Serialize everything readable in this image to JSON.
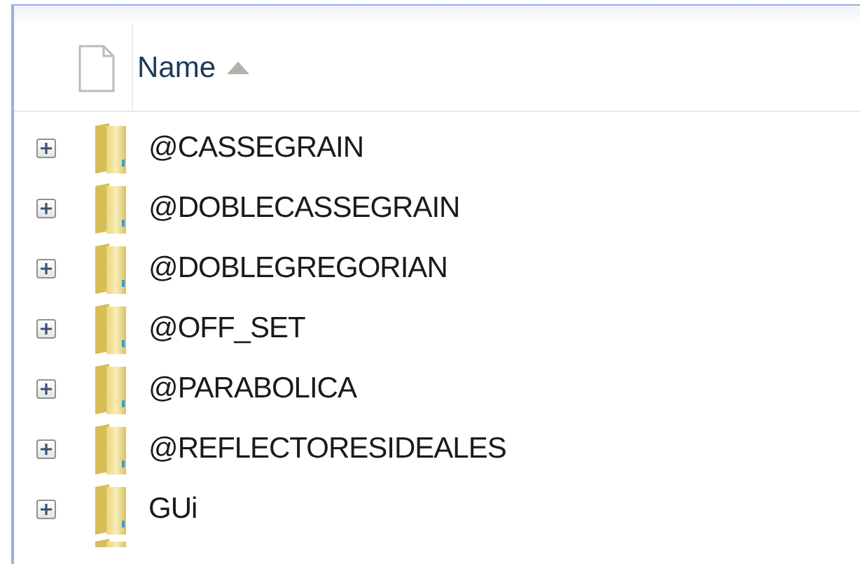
{
  "header": {
    "column": "Name",
    "sort_ascending": true
  },
  "rows": [
    {
      "name": "@CASSEGRAIN",
      "expanded": false
    },
    {
      "name": "@DOBLECASSEGRAIN",
      "expanded": false
    },
    {
      "name": "@DOBLEGREGORIAN",
      "expanded": false
    },
    {
      "name": "@OFF_SET",
      "expanded": false
    },
    {
      "name": "@PARABOLICA",
      "expanded": false
    },
    {
      "name": "@REFLECTORESIDEALES",
      "expanded": false
    },
    {
      "name": "GUi",
      "expanded": false
    }
  ]
}
